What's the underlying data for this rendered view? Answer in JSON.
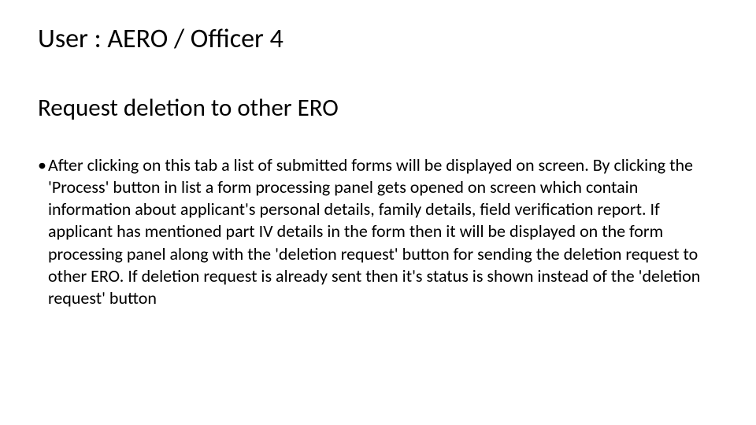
{
  "title": "User : AERO / Officer 4",
  "subtitle": "Request deletion to other ERO",
  "bullet": "•",
  "body": "After clicking on this tab a list of submitted forms will be displayed on screen. By clicking the  'Process' button in list a form processing panel gets opened on screen which contain information about applicant's personal details, family details, field verification report. If applicant has mentioned part IV details in the form then it will be displayed on the form processing panel along with the 'deletion request' button for sending the deletion request to other ERO. If deletion request is already sent then it's status is shown instead of the 'deletion request' button"
}
